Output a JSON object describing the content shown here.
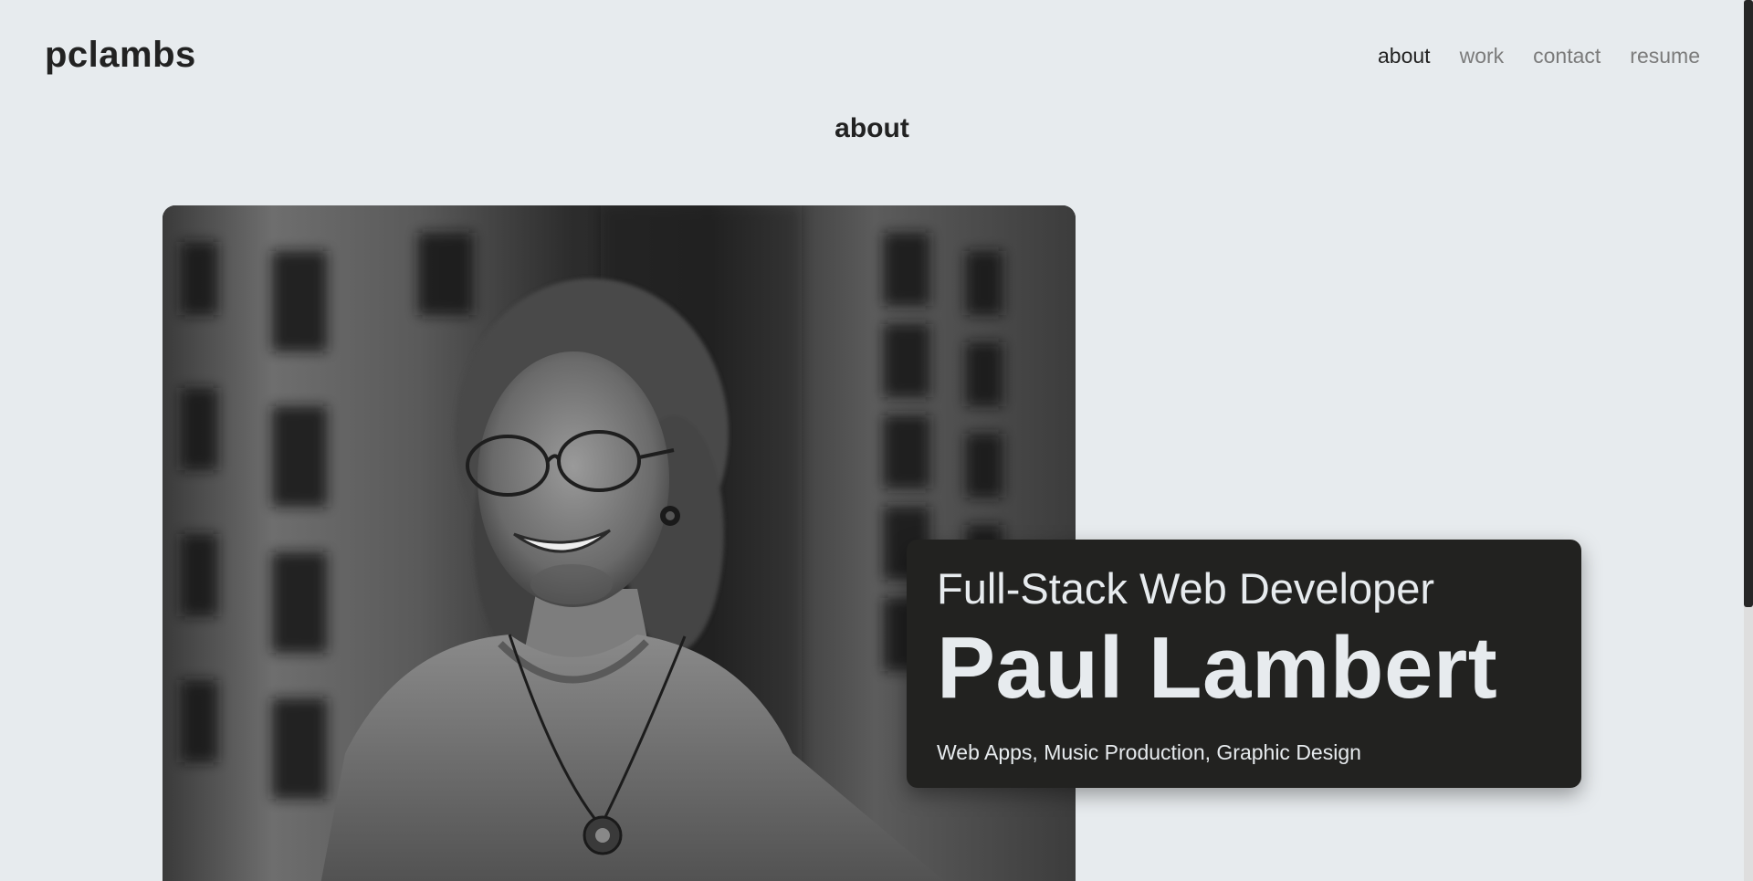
{
  "brand": {
    "name": "pclambs"
  },
  "nav": {
    "items": [
      {
        "label": "about",
        "active": true
      },
      {
        "label": "work",
        "active": false
      },
      {
        "label": "contact",
        "active": false
      },
      {
        "label": "resume",
        "active": false
      }
    ]
  },
  "section": {
    "title": "about"
  },
  "hero": {
    "role": "Full-Stack Web Developer",
    "name": "Paul Lambert",
    "skills": "Web Apps, Music Production, Graphic Design"
  },
  "colors": {
    "background": "#e7ebee",
    "card": "#222220",
    "text_dark": "#222222",
    "nav_inactive": "#7b7b7b"
  }
}
